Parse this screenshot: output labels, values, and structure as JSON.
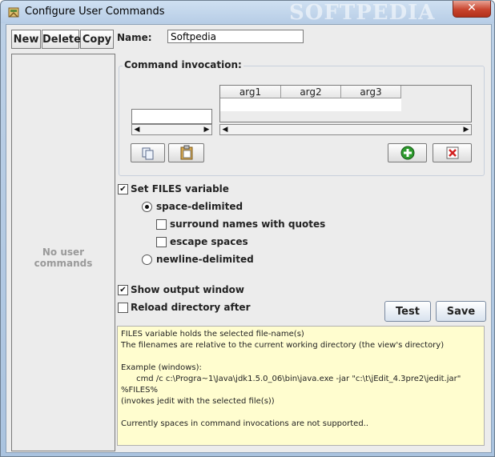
{
  "window": {
    "title": "Configure User Commands",
    "close_label": "✕",
    "watermark": "SOFTPEDIA"
  },
  "toolbar": {
    "new_label": "New",
    "delete_label": "Delete",
    "copy_label": "Copy"
  },
  "commands_list": {
    "empty_text": "No user commands"
  },
  "form": {
    "name_label": "Name:",
    "name_value": "Softpedia"
  },
  "invocation": {
    "title": "Command invocation:",
    "columns": [
      "arg1",
      "arg2",
      "arg3"
    ]
  },
  "files": {
    "set_files_label": "Set FILES variable",
    "set_files_checked": true,
    "space_delimited_label": "space-delimited",
    "space_delimited_selected": true,
    "quotes_label": "surround names with quotes",
    "quotes_checked": false,
    "escape_label": "escape spaces",
    "escape_checked": false,
    "newline_delimited_label": "newline-delimited",
    "newline_delimited_selected": false
  },
  "options": {
    "show_output_label": "Show output window",
    "show_output_checked": true,
    "reload_label": "Reload directory after",
    "reload_checked": false
  },
  "actions": {
    "test_label": "Test",
    "save_label": "Save"
  },
  "help": {
    "lines": [
      "FILES variable holds the selected file-name(s)",
      "The filenames are relative to the current working directory (the view's directory)",
      "",
      "Example (windows):",
      "      cmd /c c:\\Progra~1\\Java\\jdk1.5.0_06\\bin\\java.exe -jar \"c:\\t\\jEdit_4.3pre2\\jedit.jar\"",
      "%FILES%",
      "(invokes jedit with the selected file(s))",
      "",
      "Currently spaces in command invocations are not supported.."
    ]
  },
  "colors": {
    "help_bg": "#fffdcf",
    "add_icon": "#2e9b2e",
    "remove_icon": "#d22020"
  }
}
